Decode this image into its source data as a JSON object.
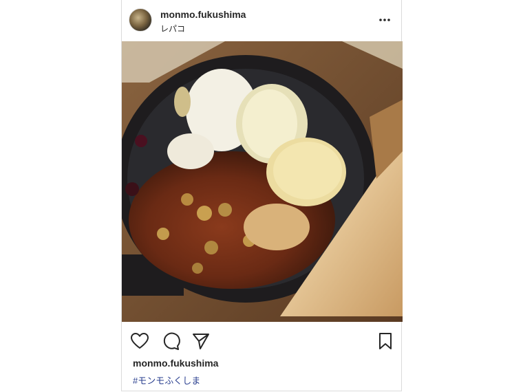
{
  "post": {
    "username": "monmo.fukushima",
    "location": "レパコ"
  },
  "icons": {
    "more": "more-options-icon",
    "like": "heart-icon",
    "comment": "comment-icon",
    "share": "paper-plane-icon",
    "save": "bookmark-icon"
  },
  "caption": {
    "username": "monmo.fukushima",
    "hashtag": "#モンモふくしま"
  },
  "colors": {
    "text": "#262626",
    "hashtag": "#2a3f8f",
    "border": "#dbdbdb"
  }
}
